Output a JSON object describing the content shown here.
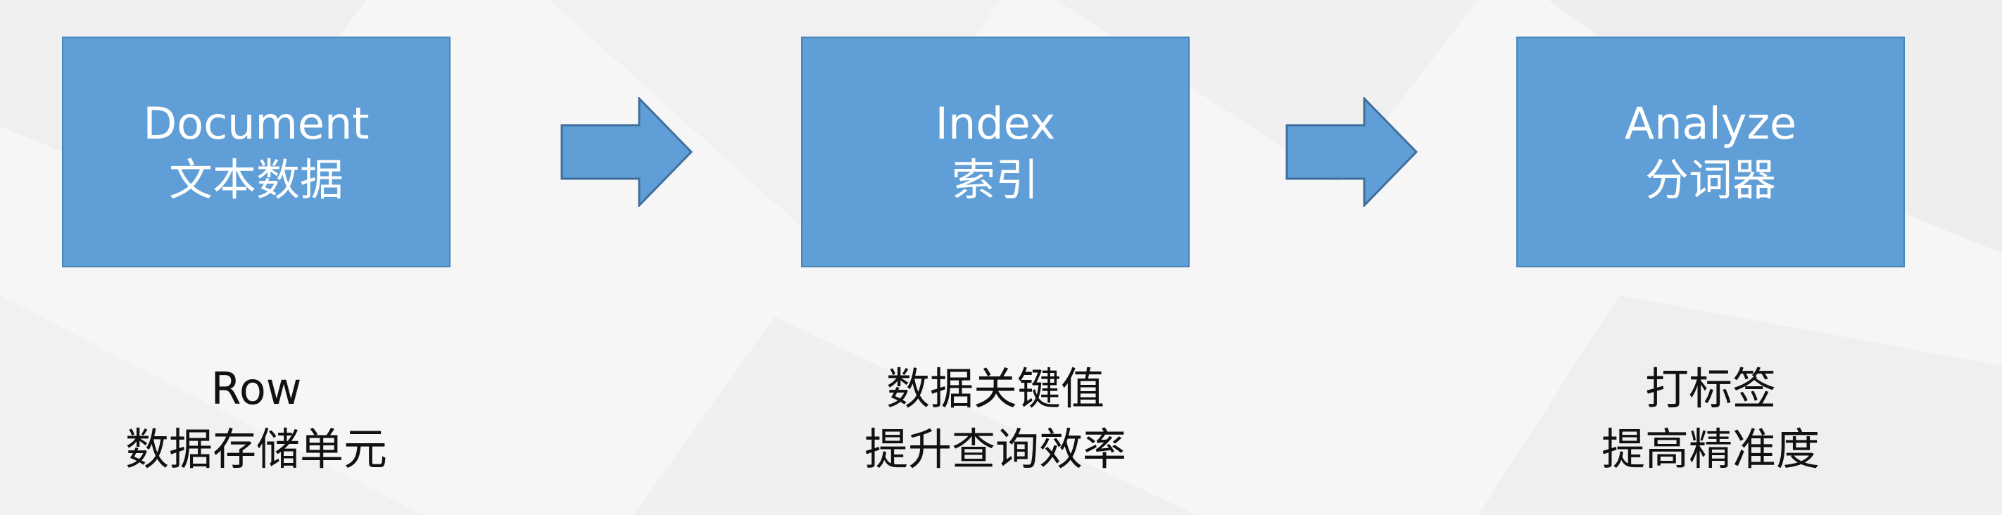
{
  "colors": {
    "box_fill": "#5f9ed6",
    "box_border": "#4a84b8",
    "arrow_fill": "#5f9ed6",
    "arrow_stroke": "#3f6f9c",
    "text_on_box": "#ffffff",
    "caption_text": "#111111"
  },
  "steps": [
    {
      "title_en": "Document",
      "title_zh": "文本数据",
      "caption_line1": "Row",
      "caption_line2": "数据存储单元"
    },
    {
      "title_en": "Index",
      "title_zh": "索引",
      "caption_line1": "数据关键值",
      "caption_line2": "提升查询效率"
    },
    {
      "title_en": "Analyze",
      "title_zh": "分词器",
      "caption_line1": "打标签",
      "caption_line2": "提高精准度"
    }
  ],
  "arrows": [
    {
      "icon": "right-arrow-icon"
    },
    {
      "icon": "right-arrow-icon"
    }
  ]
}
